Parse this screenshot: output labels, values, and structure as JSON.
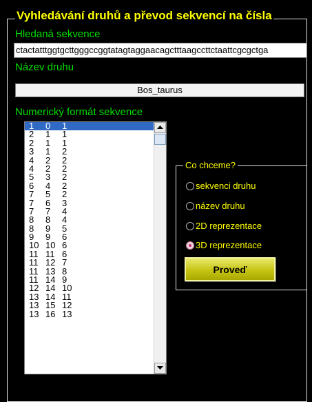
{
  "title": "Vyhledávání druhů a převod sekvencí na čísla",
  "search": {
    "label": "Hledaná sekvence",
    "value": "ctactatttggtgcttgggccggtatagtaggaacagctttaagccttctaattcgcgctga"
  },
  "species": {
    "label": "Název druhu",
    "value": "Bos_taurus"
  },
  "numeric": {
    "label": "Numerický formát sekvence",
    "rows": [
      [
        "1",
        "0",
        "1"
      ],
      [
        "2",
        "1",
        "1"
      ],
      [
        "2",
        "1",
        "1"
      ],
      [
        "3",
        "1",
        "2"
      ],
      [
        "4",
        "2",
        "2"
      ],
      [
        "4",
        "2",
        "2"
      ],
      [
        "5",
        "3",
        "2"
      ],
      [
        "6",
        "4",
        "2"
      ],
      [
        "7",
        "5",
        "2"
      ],
      [
        "7",
        "6",
        "3"
      ],
      [
        "7",
        "7",
        "4"
      ],
      [
        "8",
        "8",
        "4"
      ],
      [
        "8",
        "9",
        "5"
      ],
      [
        "9",
        "9",
        "6"
      ],
      [
        "10",
        "10",
        "6"
      ],
      [
        "11",
        "11",
        "6"
      ],
      [
        "11",
        "12",
        "7"
      ],
      [
        "11",
        "13",
        "8"
      ],
      [
        "11",
        "14",
        "9"
      ],
      [
        "12",
        "14",
        "10"
      ],
      [
        "13",
        "14",
        "11"
      ],
      [
        "13",
        "15",
        "12"
      ],
      [
        "13",
        "16",
        "13"
      ]
    ]
  },
  "options": {
    "title": "Co chceme?",
    "items": [
      "sekvenci druhu",
      "název druhu",
      "2D reprezentace",
      "3D reprezentace"
    ],
    "selected_index": 3
  },
  "action": {
    "label": "Proveď"
  }
}
